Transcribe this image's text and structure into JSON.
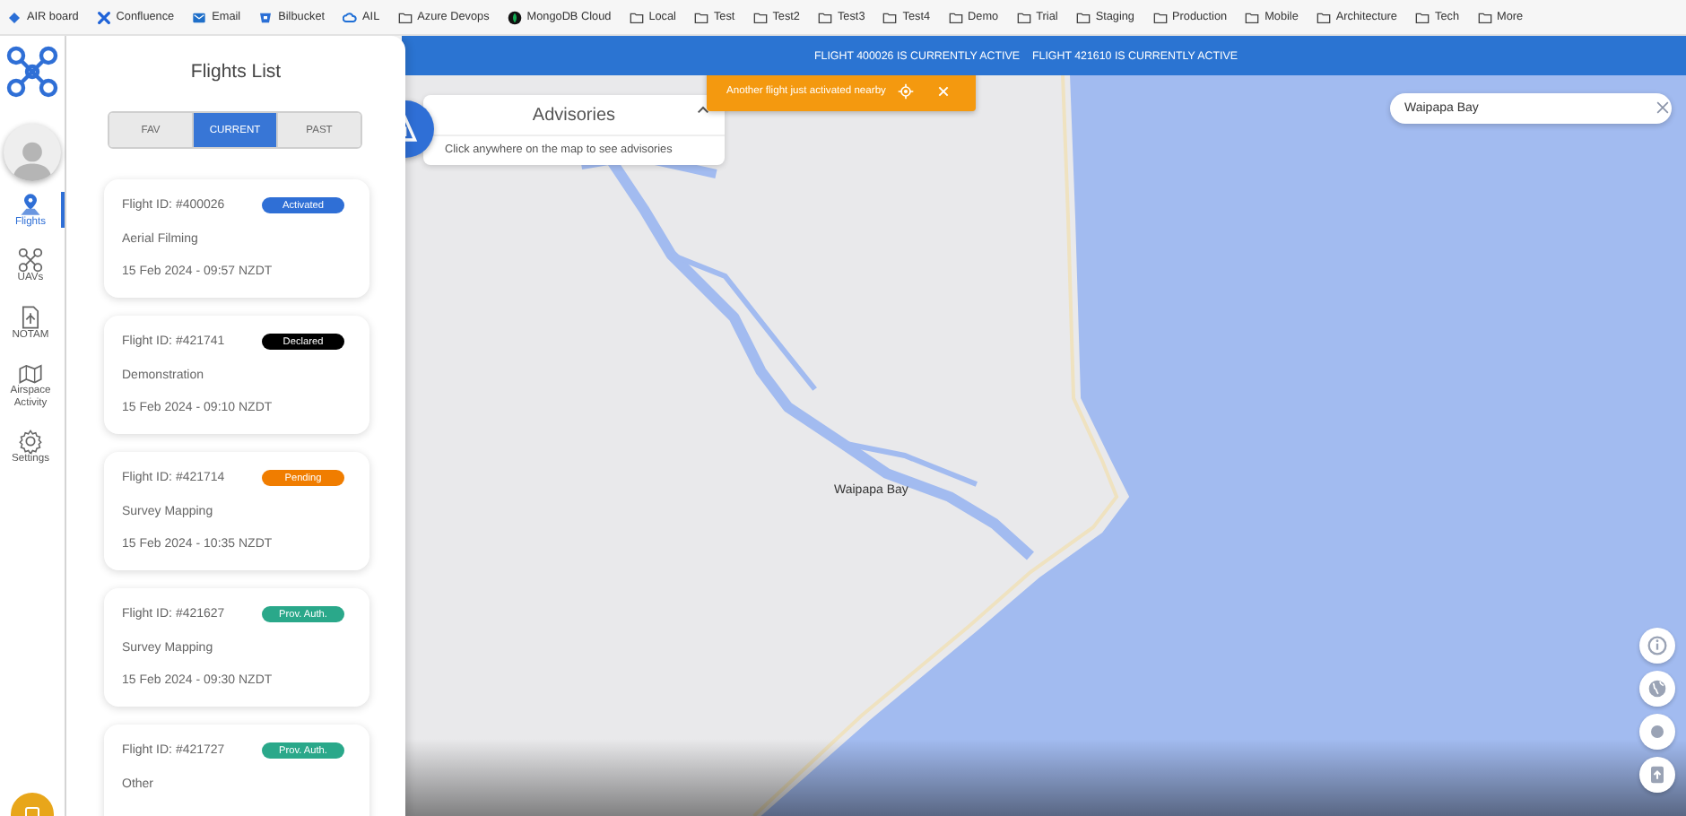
{
  "bookmarks": [
    {
      "label": "AIR board",
      "kind": "diamond"
    },
    {
      "label": "Confluence",
      "kind": "cross"
    },
    {
      "label": "Email",
      "kind": "mail"
    },
    {
      "label": "Bilbucket",
      "kind": "bucket"
    },
    {
      "label": "AIL",
      "kind": "cloud"
    },
    {
      "label": "Azure Devops",
      "kind": "folder"
    },
    {
      "label": "MongoDB Cloud",
      "kind": "leaf"
    },
    {
      "label": "Local",
      "kind": "folder"
    },
    {
      "label": "Test",
      "kind": "folder"
    },
    {
      "label": "Test2",
      "kind": "folder"
    },
    {
      "label": "Test3",
      "kind": "folder"
    },
    {
      "label": "Test4",
      "kind": "folder"
    },
    {
      "label": "Demo",
      "kind": "folder"
    },
    {
      "label": "Trial",
      "kind": "folder"
    },
    {
      "label": "Staging",
      "kind": "folder"
    },
    {
      "label": "Production",
      "kind": "folder"
    },
    {
      "label": "Mobile",
      "kind": "folder"
    },
    {
      "label": "Architecture",
      "kind": "folder"
    },
    {
      "label": "Tech",
      "kind": "folder"
    },
    {
      "label": "More",
      "kind": "folder"
    }
  ],
  "nav": {
    "items": [
      {
        "label": "Flights",
        "kind": "pin",
        "selected": true
      },
      {
        "label": "UAVs",
        "kind": "drone",
        "selected": false
      },
      {
        "label": "NOTAM",
        "kind": "document",
        "selected": false
      },
      {
        "label": "Airspace Activity",
        "kind": "map",
        "selected": false
      },
      {
        "label": "Settings",
        "kind": "gear",
        "selected": false
      }
    ]
  },
  "flights_panel": {
    "title": "Flights List",
    "tabs": [
      {
        "label": "FAV",
        "selected": false
      },
      {
        "label": "CURRENT",
        "selected": true
      },
      {
        "label": "PAST",
        "selected": false
      }
    ],
    "flights": [
      {
        "id": "Flight ID: #400026",
        "status": "Activated",
        "color": "#2f6fd6",
        "purpose": "Aerial Filming",
        "time": "15 Feb 2024 - 09:57 NZDT"
      },
      {
        "id": "Flight ID: #421741",
        "status": "Declared",
        "color": "#000000",
        "purpose": "Demonstration",
        "time": "15 Feb 2024 - 09:10 NZDT"
      },
      {
        "id": "Flight ID: #421714",
        "status": "Pending",
        "color": "#f07d00",
        "purpose": "Survey Mapping",
        "time": "15 Feb 2024 - 10:35 NZDT"
      },
      {
        "id": "Flight ID: #421627",
        "status": "Prov. Auth.",
        "color": "#2aa88a",
        "purpose": "Survey Mapping",
        "time": "15 Feb 2024 - 09:30 NZDT"
      },
      {
        "id": "Flight ID: #421727",
        "status": "Prov. Auth.",
        "color": "#2aa88a",
        "purpose": "Other"
      }
    ]
  },
  "banner": [
    "FLIGHT 400026 IS CURRENTLY ACTIVE",
    "FLIGHT 421610 IS CURRENTLY ACTIVE"
  ],
  "toast": {
    "message": "Another flight just activated nearby"
  },
  "advisories": {
    "title": "Advisories",
    "expanded": true,
    "hint": "Click anywhere on the map to see advisories"
  },
  "search": {
    "value": "Waipapa Bay"
  },
  "map": {
    "place_label": "Waipapa Bay"
  },
  "map_buttons": [
    {
      "kind": "info"
    },
    {
      "kind": "globe"
    },
    {
      "kind": "dot"
    },
    {
      "kind": "upload"
    }
  ]
}
